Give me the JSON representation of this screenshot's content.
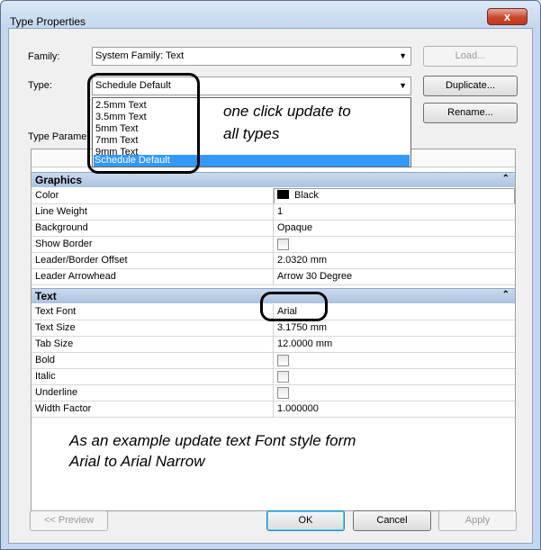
{
  "window": {
    "title": "Type Properties",
    "close_label": "x"
  },
  "family": {
    "label": "Family:",
    "value": "System Family: Text"
  },
  "type": {
    "label": "Type:",
    "value": "Schedule Default",
    "options": [
      "2.5mm Text",
      "3.5mm Text",
      "5mm Text",
      "7mm Text",
      "9mm Text",
      "Schedule Default"
    ]
  },
  "buttons": {
    "load": "Load...",
    "duplicate": "Duplicate...",
    "rename": "Rename...",
    "preview": "<< Preview",
    "ok": "OK",
    "cancel": "Cancel",
    "apply": "Apply"
  },
  "type_params_label": "Type Parame",
  "groups": [
    {
      "name": "Graphics",
      "rows": [
        {
          "name": "Color",
          "value": "Black",
          "kind": "color"
        },
        {
          "name": "Line Weight",
          "value": "1",
          "kind": "text"
        },
        {
          "name": "Background",
          "value": "Opaque",
          "kind": "text"
        },
        {
          "name": "Show Border",
          "value": "",
          "kind": "check"
        },
        {
          "name": "Leader/Border Offset",
          "value": "2.0320 mm",
          "kind": "text"
        },
        {
          "name": "Leader Arrowhead",
          "value": "Arrow 30 Degree",
          "kind": "text"
        }
      ]
    },
    {
      "name": "Text",
      "rows": [
        {
          "name": "Text Font",
          "value": "Arial",
          "kind": "text"
        },
        {
          "name": "Text Size",
          "value": "3.1750 mm",
          "kind": "text"
        },
        {
          "name": "Tab Size",
          "value": "12.0000 mm",
          "kind": "text"
        },
        {
          "name": "Bold",
          "value": "",
          "kind": "check"
        },
        {
          "name": "Italic",
          "value": "",
          "kind": "check"
        },
        {
          "name": "Underline",
          "value": "",
          "kind": "check"
        },
        {
          "name": "Width Factor",
          "value": "1.000000",
          "kind": "text"
        }
      ]
    }
  ],
  "annotations": {
    "dropdown_note_line1": "one click update to",
    "dropdown_note_line2": "all types",
    "font_note_line1": "As an example update text Font style form",
    "font_note_line2": "Arial to Arial Narrow"
  },
  "colors": {
    "selection": "#3399ff",
    "group_header": "#adc3e0",
    "window_frame": "#c4d7ee",
    "close_button": "#c9462c"
  }
}
